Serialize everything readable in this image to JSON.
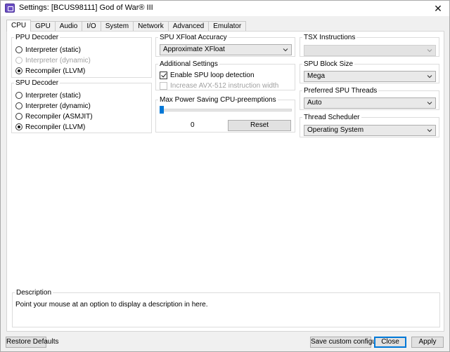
{
  "window": {
    "title": "Settings: [BCUS98111] God of War® III",
    "close_glyph": "✕",
    "icon": "app-icon"
  },
  "tabs": [
    {
      "label": "CPU",
      "active": true
    },
    {
      "label": "GPU"
    },
    {
      "label": "Audio"
    },
    {
      "label": "I/O"
    },
    {
      "label": "System"
    },
    {
      "label": "Network"
    },
    {
      "label": "Advanced"
    },
    {
      "label": "Emulator"
    }
  ],
  "ppu_decoder": {
    "title": "PPU Decoder",
    "options": [
      "Interpreter (static)",
      "Interpreter (dynamic)",
      "Recompiler (LLVM)"
    ],
    "selected": "Recompiler (LLVM)",
    "disabled": [
      "Interpreter (dynamic)"
    ]
  },
  "spu_decoder": {
    "title": "SPU Decoder",
    "options": [
      "Interpreter (static)",
      "Interpreter (dynamic)",
      "Recompiler (ASMJIT)",
      "Recompiler (LLVM)"
    ],
    "selected": "Recompiler (LLVM)"
  },
  "spu_xfloat": {
    "title": "SPU XFloat Accuracy",
    "value": "Approximate XFloat"
  },
  "additional": {
    "title": "Additional Settings",
    "enable_spu_loop": {
      "label": "Enable SPU loop detection",
      "checked": true
    },
    "avx512": {
      "label": "Increase AVX-512 instruction width",
      "checked": false,
      "disabled": true
    }
  },
  "max_power": {
    "title": "Max Power Saving CPU-preemptions",
    "value": "0",
    "slider_fraction": 0,
    "reset_label": "Reset"
  },
  "tsx": {
    "title": "TSX Instructions",
    "value": ""
  },
  "spu_block": {
    "title": "SPU Block Size",
    "value": "Mega"
  },
  "spu_threads": {
    "title": "Preferred SPU Threads",
    "value": "Auto"
  },
  "scheduler": {
    "title": "Thread Scheduler",
    "value": "Operating System"
  },
  "description": {
    "title": "Description",
    "text": "Point your mouse at an option to display a description in here."
  },
  "footer": {
    "restore": "Restore Defaults",
    "save_custom": "Save custom configuration",
    "close": "Close",
    "apply": "Apply"
  },
  "colors": {
    "accent": "#0078d7",
    "title_icon": "#6c4fc4"
  }
}
